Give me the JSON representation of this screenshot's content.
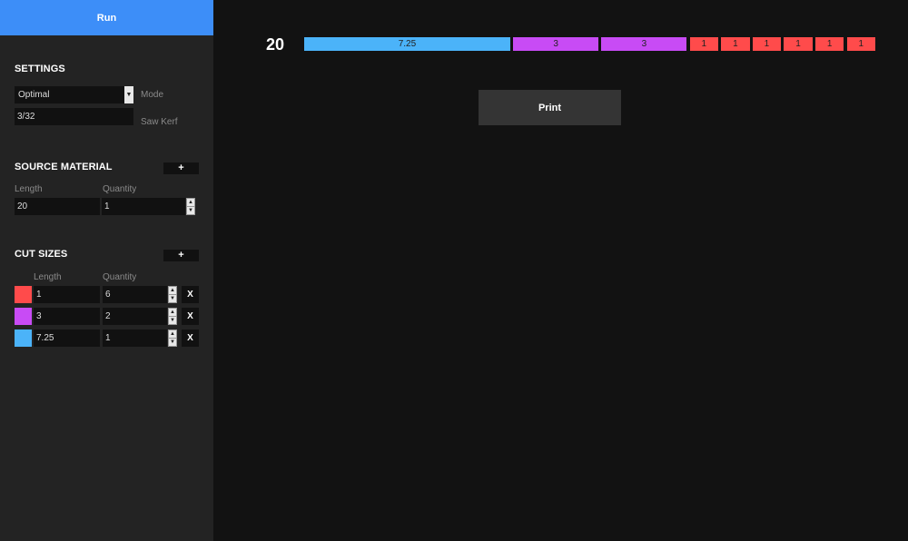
{
  "run_label": "Run",
  "settings": {
    "title": "SETTINGS",
    "mode_value": "Optimal",
    "mode_label": "Mode",
    "kerf_value": "3/32",
    "kerf_label": "Saw Kerf"
  },
  "source": {
    "title": "SOURCE MATERIAL",
    "add_label": "+",
    "length_header": "Length",
    "quantity_header": "Quantity",
    "length": "20",
    "quantity": "1"
  },
  "cuts": {
    "title": "CUT SIZES",
    "add_label": "+",
    "length_header": "Length",
    "quantity_header": "Quantity",
    "remove_label": "X",
    "rows": [
      {
        "color": "#ff4b4b",
        "length": "1",
        "quantity": "6"
      },
      {
        "color": "#c84bf5",
        "length": "3",
        "quantity": "2"
      },
      {
        "color": "#4bb3f9",
        "length": "7.25",
        "quantity": "1"
      }
    ]
  },
  "result": {
    "stock_length": "20",
    "pieces": [
      {
        "label": "7.25",
        "color": "#4bb3f9"
      },
      {
        "label": "3",
        "color": "#c84bf5"
      },
      {
        "label": "3",
        "color": "#c84bf5"
      },
      {
        "label": "1",
        "color": "#ff4b4b"
      },
      {
        "label": "1",
        "color": "#ff4b4b"
      },
      {
        "label": "1",
        "color": "#ff4b4b"
      },
      {
        "label": "1",
        "color": "#ff4b4b"
      },
      {
        "label": "1",
        "color": "#ff4b4b"
      },
      {
        "label": "1",
        "color": "#ff4b4b"
      }
    ]
  },
  "print_label": "Print"
}
